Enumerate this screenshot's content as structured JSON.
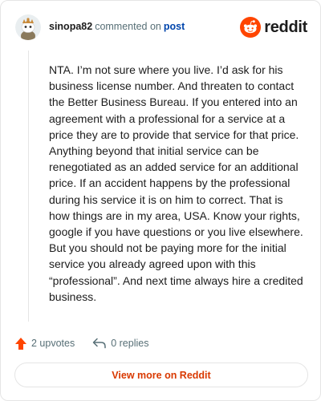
{
  "comment": {
    "username": "sinopa82",
    "action_text": "commented on",
    "target_text": "post",
    "body": "NTA. I’m not sure where you live. I’d ask for his business license number. And threaten to contact the Better Business Bureau. If you entered into an agreement with a professional for a service at a price they are to provide that service for that price. Anything beyond that initial service can be renegotiated as an added service for an additional price. If an accident happens by the professional during his service it is on him to correct. That is how things are in my area, USA. Know your rights, google if you have questions or you live elsewhere. But you should not be paying more for the initial service you already agreed upon with this “professional”. And next time always hire a credited business.",
    "upvotes_label": "2 upvotes",
    "replies_label": "0 replies"
  },
  "brand": {
    "wordmark": "reddit",
    "icon": "reddit-snoo-icon",
    "color": "#ff4500"
  },
  "footer": {
    "view_more_label": "View more on Reddit"
  },
  "colors": {
    "upvote_arrow": "#ff4500",
    "link_blue": "#0045ac",
    "cta_text": "#d93900",
    "muted": "#576f76"
  }
}
